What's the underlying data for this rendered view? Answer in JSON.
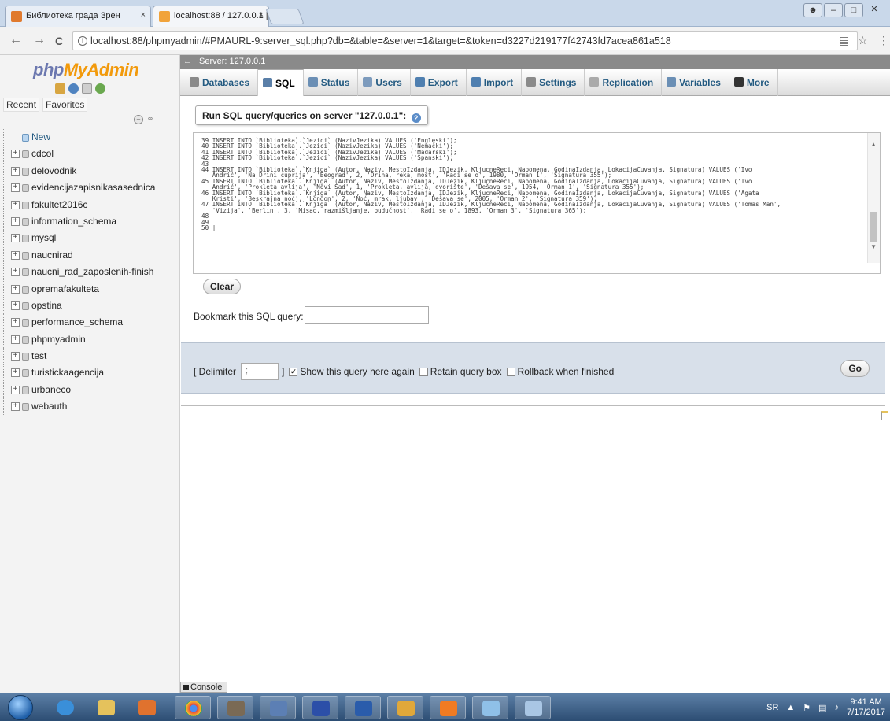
{
  "browser": {
    "tabs": [
      {
        "title": "Библиотека града Зрен",
        "close": "×"
      },
      {
        "title": "localhost:88 / 127.0.0.1 |",
        "close": "×"
      }
    ],
    "url": "localhost:88/phpmyadmin/#PMAURL-9:server_sql.php?db=&table=&server=1&target=&token=d3227d219177f42743fd7acea861a518",
    "nav": {
      "back": "←",
      "forward": "→",
      "reload": "C"
    }
  },
  "sidebar": {
    "logo_php": "php",
    "logo_myadmin": "MyAdmin",
    "recent": "Recent",
    "favorites": "Favorites",
    "new": "New",
    "databases": [
      "cdcol",
      "delovodnik",
      "evidencijazapisnikasasednica",
      "fakultet2016c",
      "information_schema",
      "mysql",
      "naucnirad",
      "naucni_rad_zaposlenih-finish",
      "opremafakulteta",
      "opstina",
      "performance_schema",
      "phpmyadmin",
      "test",
      "turistickaagencija",
      "urbaneco",
      "webauth"
    ]
  },
  "server_bar": {
    "label": "Server: 127.0.0.1"
  },
  "menu": {
    "items": [
      {
        "label": "Databases",
        "icon": "databases-icon",
        "color": "#8a8a8a"
      },
      {
        "label": "SQL",
        "icon": "sql-icon",
        "color": "#5a7fa8"
      },
      {
        "label": "Status",
        "icon": "status-icon",
        "color": "#6b8fb5"
      },
      {
        "label": "Users",
        "icon": "users-icon",
        "color": "#7d9bbd"
      },
      {
        "label": "Export",
        "icon": "export-icon",
        "color": "#4f7fb0"
      },
      {
        "label": "Import",
        "icon": "import-icon",
        "color": "#4f7fb0"
      },
      {
        "label": "Settings",
        "icon": "settings-icon",
        "color": "#8a8a8a"
      },
      {
        "label": "Replication",
        "icon": "replication-icon",
        "color": "#aaaaaa"
      },
      {
        "label": "Variables",
        "icon": "variables-icon",
        "color": "#6b8fb5"
      },
      {
        "label": "More",
        "icon": "more-icon",
        "color": "#333333"
      }
    ],
    "active": "SQL"
  },
  "sql": {
    "legend": "Run SQL query/queries on server \"127.0.0.1\":",
    "editor_text": "39 INSERT INTO `Biblioteka`.`Jezici` (NazivJezika) VALUES ('Engleski');\n40 INSERT INTO `Biblioteka`.`Jezici` (NazivJezika) VALUES ('Nemački');\n41 INSERT INTO `Biblioteka`.`Jezici` (NazivJezika) VALUES ('Mađarski');\n42 INSERT INTO `Biblioteka`.`Jezici` (NazivJezika) VALUES ('Španski');\n43\n44 INSERT INTO `Biblioteka`.`Knjiga` (Autor, Naziv, MestoIzdanja, IDJezik, KljucneReci, Napomena, GodinaIzdanja, LokacijaCuvanja, Signatura) VALUES ('Ivo\n   Andrić', 'Na Drini ćuprija', 'Beograd', 2, 'Drina, reka, most', 'Radi se o', 1980, 'Orman 1', 'Signatura 355');\n45 INSERT INTO `Biblioteka`.`Knjiga` (Autor, Naziv, MestoIzdanja, IDJezik, KljucneReci, Napomena, GodinaIzdanja, LokacijaCuvanja, Signatura) VALUES ('Ivo\n   Andrić', 'Prokleta avlija', 'Novi Sad', 1, 'Prokleta, avlija, dvorište', 'Dešava se', 1954, 'Orman 1', 'Signatura 355');\n46 INSERT INTO `Biblioteka`.`Knjiga` (Autor, Naziv, MestoIzdanja, IDJezik, KljucneReci, Napomena, GodinaIzdanja, LokacijaCuvanja, Signatura) VALUES ('Agata\n   Kristi', 'Beskrajna noć', 'London', 2, 'Noć, mrak, ljubav', 'Dešava se', 2005, 'Orman 2', 'Signatura 359');\n47 INSERT INTO `Biblioteka`.`Knjiga` (Autor, Naziv, MestoIzdanja, IDJezik, KljucneReci, Napomena, GodinaIzdanja, LokacijaCuvanja, Signatura) VALUES ('Tomas Man',\n   'Vizija', 'Berlin', 3, 'Misao, razmišljanje, budućnost', 'Radi se o', 1893, 'Orman 3', 'Signatura 365');\n48\n49\n50 |",
    "clear": "Clear",
    "bookmark_label": "Bookmark this SQL query:",
    "bookmark_value": ""
  },
  "options": {
    "delimiter_open": "[ Delimiter",
    "delimiter_value": ";",
    "delimiter_close": "]",
    "show_query": "Show this query here again",
    "show_query_checked": "✔",
    "retain": "Retain query box",
    "rollback": "Rollback when finished",
    "go": "Go"
  },
  "console": {
    "label": "Console"
  },
  "taskbar": {
    "lang": "SR",
    "time": "9:41 AM",
    "date": "7/17/2017"
  }
}
